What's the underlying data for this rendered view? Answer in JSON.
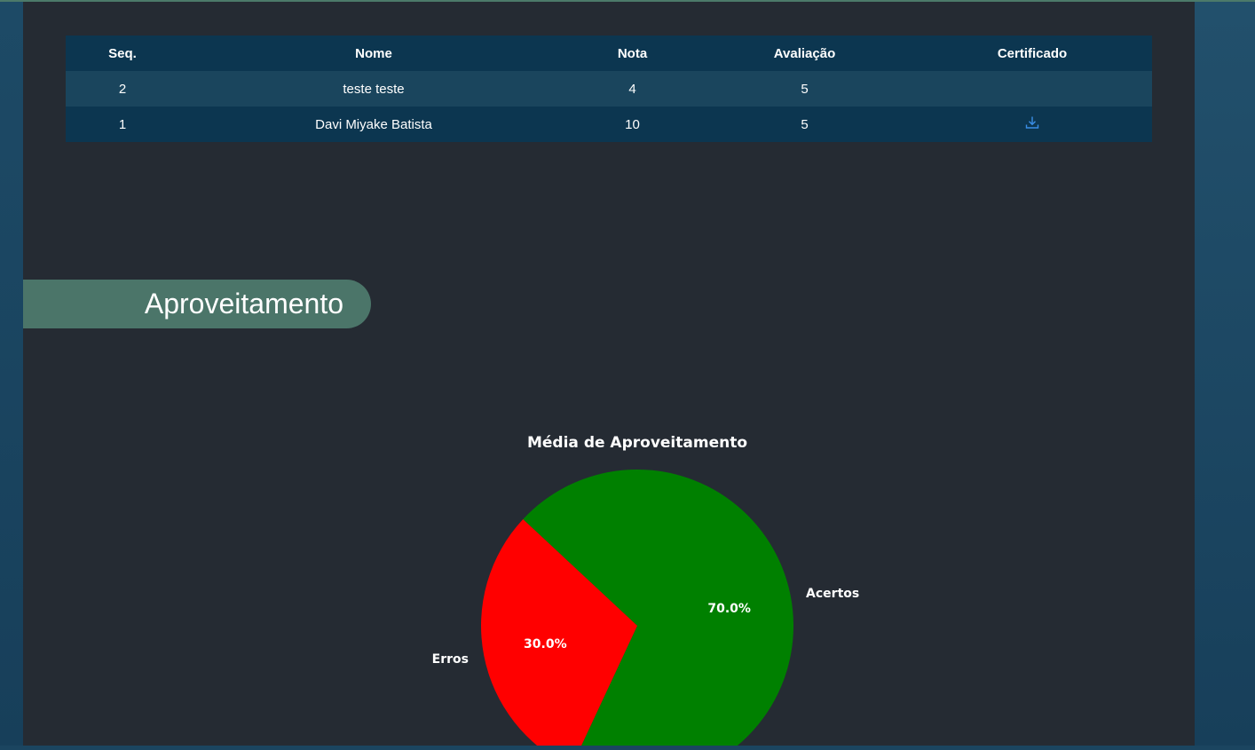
{
  "table": {
    "headers": {
      "seq": "Seq.",
      "nome": "Nome",
      "nota": "Nota",
      "avaliacao": "Avaliação",
      "certificado": "Certificado"
    },
    "rows": [
      {
        "seq": "2",
        "nome": "teste teste",
        "nota": "4",
        "avaliacao": "5",
        "certificado": ""
      },
      {
        "seq": "1",
        "nome": "Davi Miyake Batista",
        "nota": "10",
        "avaliacao": "5",
        "certificado": "download-icon"
      }
    ]
  },
  "section": {
    "title": "Aproveitamento"
  },
  "colors": {
    "acertos": "#008000",
    "erros": "#ff0000",
    "header_bg": "#0c3650",
    "tab_bg": "#4b7569",
    "icon_blue": "#3a8ee6"
  },
  "chart_data": {
    "type": "pie",
    "title": "Média de Aproveitamento",
    "categories": [
      "Acertos",
      "Erros"
    ],
    "values": [
      70.0,
      30.0
    ],
    "value_labels": [
      "70.0%",
      "30.0%"
    ],
    "colors": [
      "#008000",
      "#ff0000"
    ]
  }
}
